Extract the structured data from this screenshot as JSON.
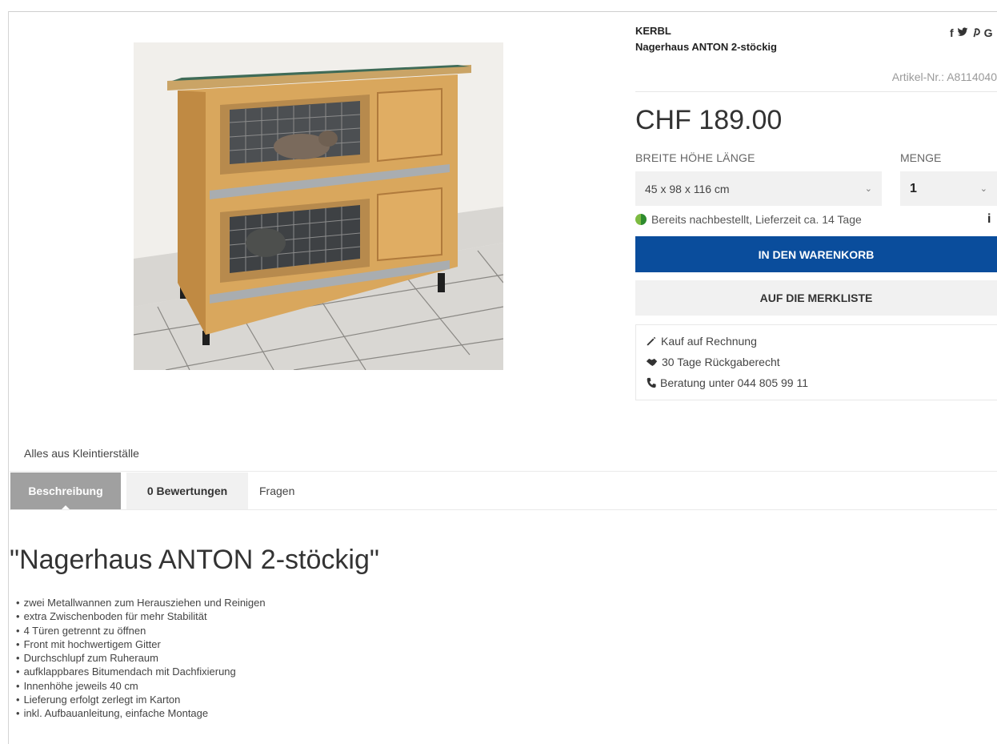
{
  "product": {
    "brand": "KERBL",
    "title": "Nagerhaus ANTON 2-stöckig",
    "article_no": "Artikel-Nr.: A8114040",
    "price": "CHF 189.00",
    "image_alt": "Nagerhaus ANTON 2-stöckig"
  },
  "share": {
    "facebook": "f",
    "twitter": "🐦",
    "pinterest": "P",
    "google": "G"
  },
  "options": {
    "size_label": "BREITE HÖHE LÄNGE",
    "size_value": "45 x 98 x 116 cm",
    "qty_label": "MENGE",
    "qty_value": "1"
  },
  "stock": {
    "text": "Bereits nachbestellt, Lieferzeit ca. 14 Tage",
    "info": "i"
  },
  "buttons": {
    "cart": "IN DEN WARENKORB",
    "wishlist": "AUF DIE MERKLISTE"
  },
  "usps": {
    "invoice": "Kauf auf Rechnung",
    "return": "30 Tage Rückgaberecht",
    "phone": "Beratung unter 044 805 99 11"
  },
  "category_link": "Alles aus Kleintierställe",
  "tabs": {
    "description": "Beschreibung",
    "reviews": "0 Bewertungen",
    "questions": "Fragen"
  },
  "description": {
    "heading": "\"Nagerhaus ANTON 2-stöckig\"",
    "features": [
      "zwei Metallwannen zum Herausziehen und Reinigen",
      "extra Zwischenboden für mehr Stabilität",
      "4 Türen getrennt zu öffnen",
      "Front mit hochwertigem Gitter",
      "Durchschlupf zum Ruheraum",
      "aufklappbares Bitumendach mit Dachfixierung",
      "Innenhöhe jeweils 40 cm",
      "Lieferung erfolgt zerlegt im Karton",
      "inkl. Aufbauanleitung, einfache Montage"
    ]
  },
  "colors": {
    "primary_button": "#0a4d9c",
    "active_tab": "#a0a0a0",
    "stock_green": "#2e8b2e"
  }
}
